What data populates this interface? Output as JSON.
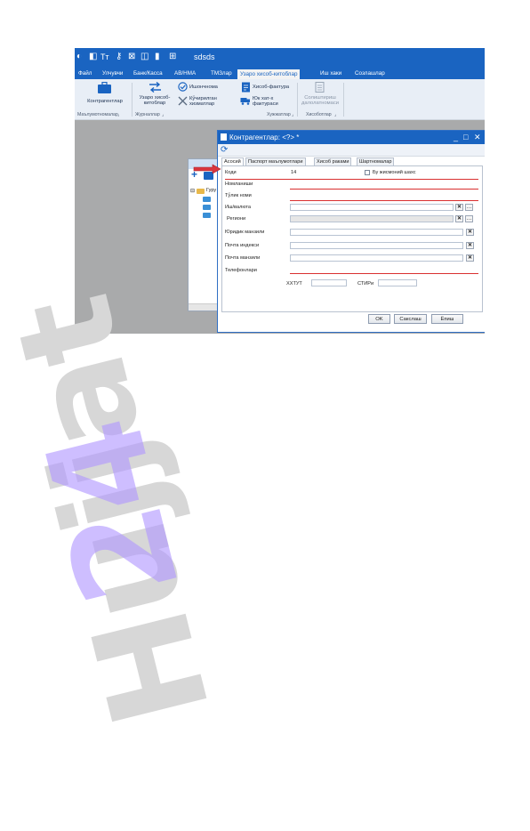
{
  "titlebar": {
    "title": "sdsds",
    "quick_icons": [
      "app-logo-icon",
      "panel-icon",
      "font-icon",
      "key-icon",
      "box-icon",
      "split-icon",
      "book-icon",
      "grid-icon"
    ]
  },
  "menu": {
    "items": [
      "Файл",
      "Улчувчи",
      "Банк/Касса",
      "АВ/НМА",
      "ТМЗлар",
      "Узаро хисоб-китоблар",
      "Иш хаки",
      "Созлашлар"
    ],
    "active_index": 5
  },
  "ribbon": {
    "buttons": {
      "kontragentlar": "Контрагентлар",
      "uzaro_line1": "Узаро хисоб-",
      "uzaro_line2": "китоблар",
      "ishonchnoma": "Ишончнома",
      "xisob_faktura": "Хисоб-фактура",
      "kuchirilgan_line1": "Кўчирилган",
      "kuchirilgan_line2": "хизматлар",
      "yuk_line1": "Юк хат-х",
      "yuk_line2": "фактураси",
      "solishtirma_line1": "Солиштириш",
      "solishtirma_line2": "далолатномаси"
    },
    "groups": [
      "Маълумотномалар",
      "Журналлар",
      "Хужжатлар",
      "Хисоботлар"
    ]
  },
  "tree": {
    "root_label": "Гуру"
  },
  "dialog": {
    "title": "Контрагентлар: <?> *",
    "tabs": [
      "Асосий",
      "Паспорт маълумотлари",
      "Хисоб раками",
      "Шартномалар"
    ],
    "active_tab": 0,
    "fields": {
      "code_label": "Коди",
      "code_value": "14",
      "individual_label": "Бу жисмоний шахс",
      "name_label": "Номланиши",
      "fullname_label": "Тўлик номи",
      "currency_label": "Иш/валюта",
      "region_label": "Региони",
      "legal_address_label": "Юридик манзили",
      "postal_index_label": "Почта индекси",
      "postal_address_label": "Почта манзили",
      "phones_label": "Телефонлари",
      "oked_label": "ХХТУТ",
      "inn_label": "СТИРи"
    },
    "buttons": {
      "ok": "OK",
      "save": "Сакслаш",
      "close": "Ёпиш"
    }
  },
  "watermark": {
    "prefix": "Hujjat",
    "suffix": "24"
  }
}
